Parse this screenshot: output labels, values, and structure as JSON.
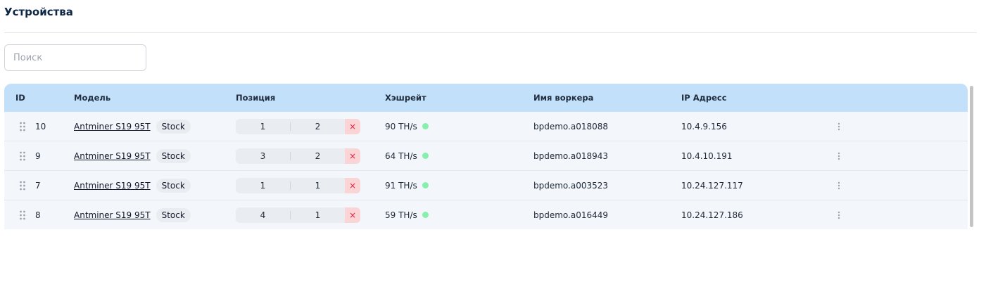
{
  "page": {
    "title": "Устройства"
  },
  "search": {
    "placeholder": "Поиск",
    "value": ""
  },
  "table": {
    "headers": {
      "id": "ID",
      "model": "Модель",
      "position": "Позиция",
      "hashrate": "Хэшрейт",
      "worker": "Имя воркера",
      "ip": "IP Адресс"
    },
    "rows": [
      {
        "id": "10",
        "model": "Antminer S19 95T",
        "tag": "Stock",
        "pos1": "1",
        "pos2": "2",
        "clear": "×",
        "hashrate": "90 TH/s",
        "status_color": "#86efac",
        "worker": "bpdemo.a018088",
        "ip": "10.4.9.156"
      },
      {
        "id": "9",
        "model": "Antminer S19 95T",
        "tag": "Stock",
        "pos1": "3",
        "pos2": "2",
        "clear": "×",
        "hashrate": "64 TH/s",
        "status_color": "#86efac",
        "worker": "bpdemo.a018943",
        "ip": "10.4.10.191"
      },
      {
        "id": "7",
        "model": "Antminer S19 95T",
        "tag": "Stock",
        "pos1": "1",
        "pos2": "1",
        "clear": "×",
        "hashrate": "91 TH/s",
        "status_color": "#86efac",
        "worker": "bpdemo.a003523",
        "ip": "10.24.127.117"
      },
      {
        "id": "8",
        "model": "Antminer S19 95T",
        "tag": "Stock",
        "pos1": "4",
        "pos2": "1",
        "clear": "×",
        "hashrate": "59 TH/s",
        "status_color": "#86efac",
        "worker": "bpdemo.a016449",
        "ip": "10.24.127.186"
      }
    ]
  },
  "icons": {
    "drag": "drag-handle-icon",
    "clear": "close-icon",
    "menu": "more-vertical-icon",
    "status": "status-dot-icon"
  },
  "colors": {
    "header_bg": "#c3e0fb",
    "row_bg": "#f3f6fb",
    "title": "#0f2747",
    "status_online": "#86efac",
    "clear_bg": "#fbd5d5",
    "clear_fg": "#e11d48"
  }
}
